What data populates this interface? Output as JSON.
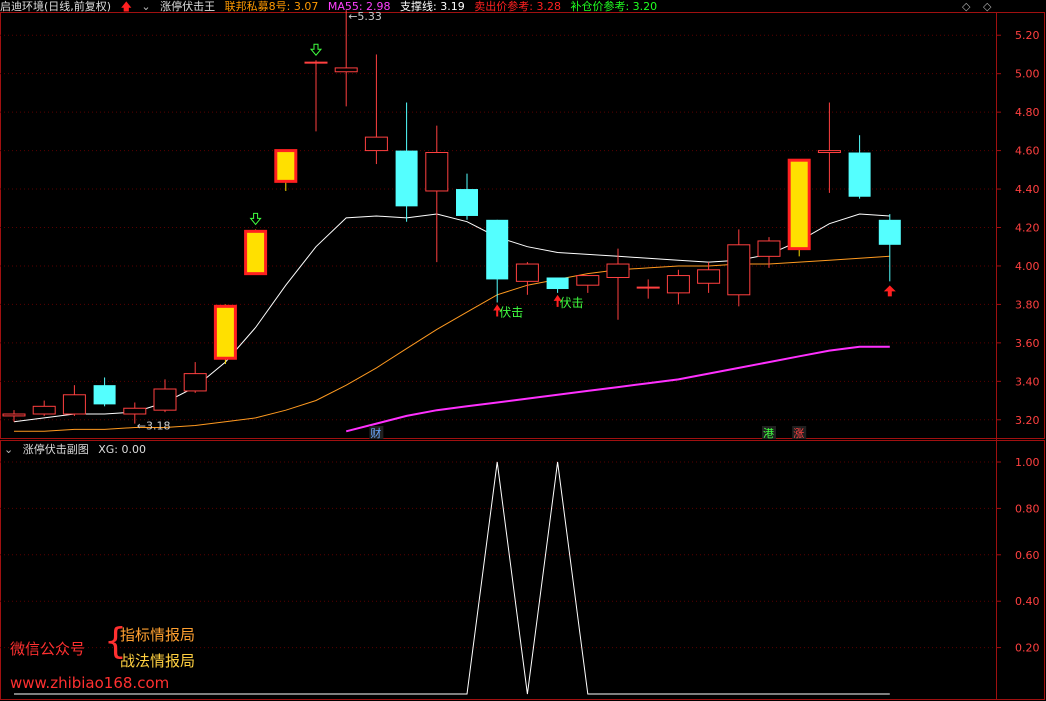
{
  "header": {
    "title": "启迪环境(日线,前复权)",
    "indicator_name": "涨停伏击王",
    "items": [
      {
        "label": "联邦私募8号: 3.07",
        "color": "#ff9900"
      },
      {
        "label": "MA55: 2.98",
        "color": "#ff40ff"
      },
      {
        "label": "支撑线: 3.19",
        "color": "#ffffff"
      },
      {
        "label": "卖出价参考: 3.28",
        "color": "#ff2020"
      },
      {
        "label": "补仓价参考: 3.20",
        "color": "#20ff20"
      }
    ]
  },
  "sub_header": {
    "name": "涨停伏击副图",
    "value": "XG: 0.00"
  },
  "watermark": {
    "left": "微信公众号",
    "right1": "指标情报局",
    "right2": "战法情报局",
    "url": "www.zhibiao168.com"
  },
  "chart_data": [
    {
      "type": "candlestick",
      "ylim": [
        3.1,
        5.3
      ],
      "yticks": [
        3.2,
        3.4,
        3.6,
        3.8,
        4.0,
        4.2,
        4.4,
        4.6,
        4.8,
        5.0,
        5.2
      ],
      "tick_labels": [
        "3.20",
        "3.40",
        "3.60",
        "3.80",
        "4.00",
        "4.20",
        "4.40",
        "4.60",
        "4.80",
        "5.00",
        "5.20"
      ],
      "candles": [
        {
          "o": 3.22,
          "h": 3.25,
          "l": 3.19,
          "c": 3.23
        },
        {
          "o": 3.23,
          "h": 3.3,
          "l": 3.22,
          "c": 3.27
        },
        {
          "o": 3.23,
          "h": 3.38,
          "l": 3.22,
          "c": 3.33
        },
        {
          "o": 3.38,
          "h": 3.42,
          "l": 3.27,
          "c": 3.28
        },
        {
          "o": 3.23,
          "h": 3.29,
          "l": 3.18,
          "c": 3.26
        },
        {
          "o": 3.25,
          "h": 3.41,
          "l": 3.24,
          "c": 3.36
        },
        {
          "o": 3.35,
          "h": 3.5,
          "l": 3.34,
          "c": 3.44
        },
        {
          "o": 3.52,
          "h": 3.8,
          "l": 3.49,
          "c": 3.79
        },
        {
          "o": 3.96,
          "h": 4.19,
          "l": 3.96,
          "c": 4.18
        },
        {
          "o": 4.44,
          "h": 4.6,
          "l": 4.39,
          "c": 4.6
        },
        {
          "o": 5.06,
          "h": 5.07,
          "l": 4.7,
          "c": 5.06
        },
        {
          "o": 5.01,
          "h": 5.33,
          "l": 4.83,
          "c": 5.03
        },
        {
          "o": 4.6,
          "h": 5.1,
          "l": 4.53,
          "c": 4.67
        },
        {
          "o": 4.6,
          "h": 4.85,
          "l": 4.23,
          "c": 4.31
        },
        {
          "o": 4.39,
          "h": 4.73,
          "l": 4.02,
          "c": 4.59
        },
        {
          "o": 4.4,
          "h": 4.48,
          "l": 4.24,
          "c": 4.26
        },
        {
          "o": 4.24,
          "h": 4.24,
          "l": 3.81,
          "c": 3.93
        },
        {
          "o": 3.92,
          "h": 4.02,
          "l": 3.85,
          "c": 4.01
        },
        {
          "o": 3.94,
          "h": 3.94,
          "l": 3.86,
          "c": 3.88
        },
        {
          "o": 3.9,
          "h": 3.95,
          "l": 3.86,
          "c": 3.95
        },
        {
          "o": 3.94,
          "h": 4.09,
          "l": 3.72,
          "c": 4.01
        },
        {
          "o": 3.89,
          "h": 3.93,
          "l": 3.83,
          "c": 3.89
        },
        {
          "o": 3.86,
          "h": 3.98,
          "l": 3.8,
          "c": 3.95
        },
        {
          "o": 3.91,
          "h": 4.02,
          "l": 3.86,
          "c": 3.98
        },
        {
          "o": 3.85,
          "h": 4.19,
          "l": 3.79,
          "c": 4.11
        },
        {
          "o": 4.05,
          "h": 4.15,
          "l": 3.99,
          "c": 4.13
        },
        {
          "o": 4.09,
          "h": 4.55,
          "l": 4.05,
          "c": 4.55
        },
        {
          "o": 4.59,
          "h": 4.85,
          "l": 4.38,
          "c": 4.6
        },
        {
          "o": 4.59,
          "h": 4.68,
          "l": 4.35,
          "c": 4.36
        },
        {
          "o": 4.24,
          "h": 4.27,
          "l": 3.92,
          "c": 4.11
        }
      ],
      "limit_up_days": [
        7,
        8,
        9,
        26
      ],
      "support_line": [
        3.19,
        3.21,
        3.23,
        3.23,
        3.24,
        3.29,
        3.37,
        3.5,
        3.68,
        3.9,
        4.1,
        4.25,
        4.26,
        4.25,
        4.27,
        4.23,
        4.15,
        4.1,
        4.07,
        4.06,
        4.05,
        4.04,
        4.03,
        4.02,
        4.03,
        4.06,
        4.13,
        4.22,
        4.27,
        4.26
      ],
      "lianbang_line": [
        3.14,
        3.14,
        3.15,
        3.15,
        3.16,
        3.16,
        3.17,
        3.19,
        3.21,
        3.25,
        3.3,
        3.38,
        3.47,
        3.57,
        3.67,
        3.76,
        3.85,
        3.9,
        3.93,
        3.96,
        3.98,
        3.99,
        4.0,
        4.0,
        4.01,
        4.01,
        4.02,
        4.03,
        4.04,
        4.05
      ],
      "ma55": [
        null,
        null,
        null,
        null,
        null,
        null,
        null,
        null,
        null,
        null,
        null,
        3.14,
        3.18,
        3.22,
        3.25,
        3.27,
        3.29,
        3.31,
        3.33,
        3.35,
        3.37,
        3.39,
        3.41,
        3.44,
        3.47,
        3.5,
        3.53,
        3.56,
        3.58,
        3.58
      ],
      "ambush_signals": [
        {
          "index": 16,
          "label": "伏击"
        },
        {
          "index": 18,
          "label": "伏击"
        }
      ],
      "sell_arrows": [
        8,
        10
      ],
      "buy_arrows": [
        29
      ],
      "annotations": [
        {
          "index": 11,
          "label": "5.33"
        },
        {
          "index": 4,
          "label": "3.18"
        }
      ],
      "event_markers": [
        {
          "index": 12,
          "label": "财",
          "color": "#6aa8ff"
        },
        {
          "index": 25,
          "label": "港",
          "color": "#40ff40"
        },
        {
          "index": 26,
          "label": "涨",
          "color": "#ff4040"
        }
      ]
    },
    {
      "type": "line",
      "name": "XG",
      "ylim": [
        0.0,
        1.0
      ],
      "tick_labels": [
        "1.00",
        "0.80",
        "0.60",
        "0.40",
        "0.20"
      ],
      "yticks": [
        1.0,
        0.8,
        0.6,
        0.4,
        0.2
      ],
      "values": [
        0,
        0,
        0,
        0,
        0,
        0,
        0,
        0,
        0,
        0,
        0,
        0,
        0,
        0,
        0,
        0,
        1,
        0,
        1,
        0,
        0,
        0,
        0,
        0,
        0,
        0,
        0,
        0,
        0,
        0
      ]
    }
  ]
}
